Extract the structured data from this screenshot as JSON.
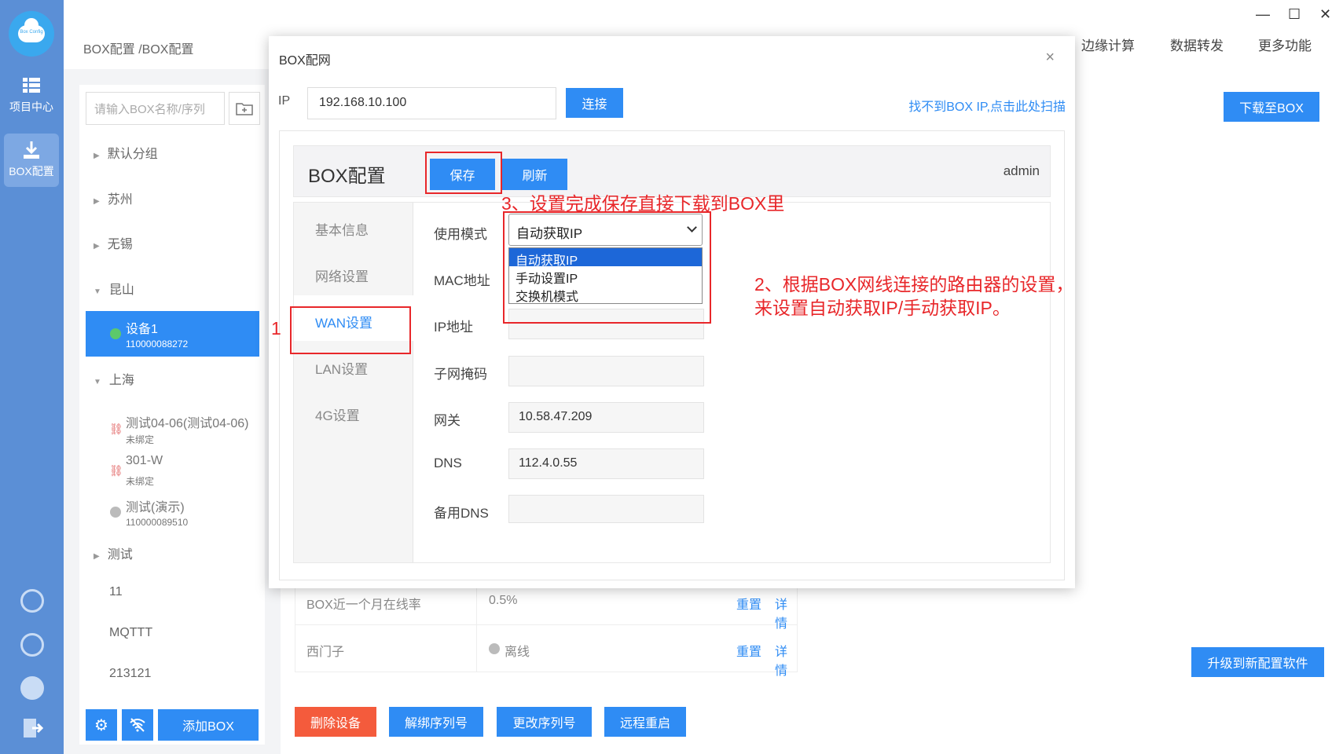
{
  "rail": {
    "logo_text": "Box Config",
    "items": [
      {
        "label": "项目中心"
      },
      {
        "label": "BOX配置"
      }
    ]
  },
  "topbar": {
    "breadcrumb": "BOX配置 /BOX配置",
    "nav": [
      "边缘计算",
      "数据转发",
      "更多功能"
    ],
    "win": {
      "min": "—",
      "max": "☐",
      "close": "✕"
    }
  },
  "tree": {
    "search_placeholder": "请输入BOX名称/序列",
    "groups": {
      "g1": "默认分组",
      "g2": "苏州",
      "g3": "无锡",
      "g4": "昆山",
      "g5": "上海",
      "g6": "测试"
    },
    "devices": {
      "d1": {
        "name": "设备1",
        "sn": "110000088272"
      },
      "d2": {
        "name": "测试04-06(测试04-06)",
        "sn": "未绑定"
      },
      "d3": {
        "name": "301-W",
        "sn": "未绑定"
      },
      "d4": {
        "name": "测试(演示)",
        "sn": "110000089510"
      }
    },
    "plain": {
      "p1": "11",
      "p2": "MQTTT",
      "p3": "213121"
    },
    "add_label": "添加BOX"
  },
  "main": {
    "download_label": "下载至BOX",
    "upgrade_label": "升级到新配置软件",
    "rows": [
      {
        "c1": "BOX近一个月在线率",
        "c2": "0.5%",
        "l1": "重置",
        "l2": "详情"
      },
      {
        "c1": "西门子",
        "c2": "离线",
        "l1": "重置",
        "l2": "详情"
      }
    ],
    "buttons": {
      "delete": "删除设备",
      "unbind": "解绑序列号",
      "change": "更改序列号",
      "reboot": "远程重启"
    },
    "colors": {
      "accent": "#2f8cf4",
      "danger": "#f45b3c"
    }
  },
  "dialog": {
    "title": "BOX配网",
    "close": "×",
    "ip_label": "IP",
    "ip_value": "192.168.10.100",
    "connect_label": "连接",
    "scan_link": "找不到BOX IP,点击此处扫描",
    "inner_title": "BOX配置",
    "save_label": "保存",
    "refresh_label": "刷新",
    "user": "admin",
    "tabs": {
      "t1": "基本信息",
      "t2": "网络设置",
      "t3": "WAN设置",
      "t4": "LAN设置",
      "t5": "4G设置"
    },
    "fields": {
      "mode_label": "使用模式",
      "mode_value": "自动获取IP",
      "mac_label": "MAC地址",
      "ip_label": "IP地址",
      "mask_label": "子网掩码",
      "gw_label": "网关",
      "gw_value": "10.58.47.209",
      "dns_label": "DNS",
      "dns_value": "112.4.0.55",
      "dns2_label": "备用DNS"
    },
    "options": {
      "o1": "自动获取IP",
      "o2": "手动设置IP",
      "o3": "交换机模式"
    }
  },
  "annotations": {
    "a1": "1",
    "a2_line1": "2、根据BOX网线连接的路由器的设置，",
    "a2_line2": "来设置自动获取IP/手动获取IP。",
    "a3": "3、设置完成保存直接下载到BOX里",
    "color": "#e8272a"
  }
}
